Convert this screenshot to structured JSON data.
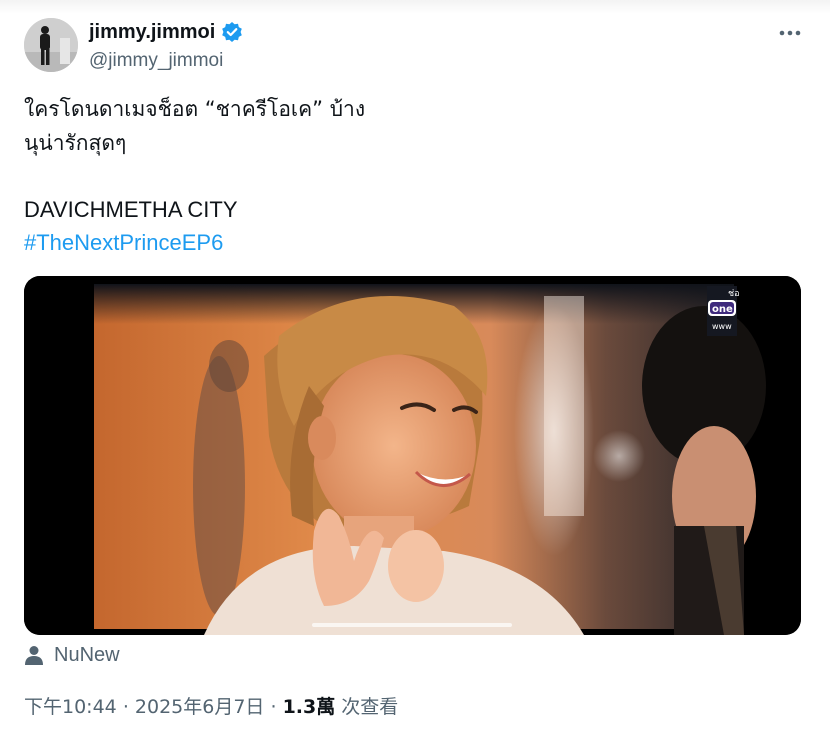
{
  "author": {
    "display_name": "jimmy.jimmoi",
    "handle": "@jimmy_jimmoi",
    "verified_color": "#1d9bf0",
    "avatar_icon": "person-photo-avatar"
  },
  "menu": {
    "more_icon": "more-horizontal-icon"
  },
  "tweet": {
    "line1": "ใครโดนดาเมจช็อต “ชาครีโอเค” บ้าง",
    "line2": "นุน่ารักสุดๆ",
    "line3": "DAVICHMETHA CITY",
    "hashtag": "#TheNextPrinceEP6"
  },
  "media": {
    "type": "photo",
    "channel_badge_text": "one",
    "channel_badge_top": "ช่อ",
    "channel_badge_bottom": "www"
  },
  "tagged": {
    "icon": "person-icon",
    "name": "NuNew"
  },
  "meta": {
    "time": "下午10:44",
    "sep1": "·",
    "date": "2025年6月7日",
    "sep2": "·",
    "views_count": "1.3萬",
    "views_label": "次查看"
  },
  "colors": {
    "text_primary": "#0f1419",
    "text_secondary": "#536471",
    "accent": "#1d9bf0"
  }
}
